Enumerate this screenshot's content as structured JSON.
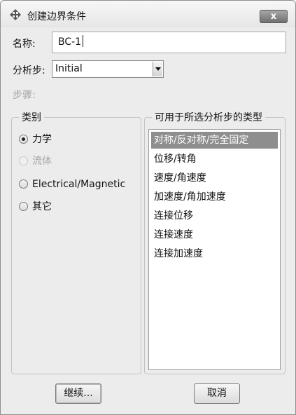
{
  "window": {
    "title": "创建边界条件",
    "close_label": "x"
  },
  "form": {
    "name_label": "名称:",
    "name_value": "BC-1",
    "step_label": "分析步:",
    "step_value": "Initial",
    "procedure_label": "步骤:"
  },
  "category": {
    "legend": "类别",
    "options": [
      {
        "label": "力学",
        "checked": true,
        "enabled": true
      },
      {
        "label": "流体",
        "checked": false,
        "enabled": false
      },
      {
        "label": "Electrical/Magnetic",
        "checked": false,
        "enabled": true
      },
      {
        "label": "其它",
        "checked": false,
        "enabled": true
      }
    ]
  },
  "types": {
    "legend": "可用于所选分析步的类型",
    "items": [
      {
        "label": "对称/反对称/完全固定",
        "selected": true
      },
      {
        "label": "位移/转角",
        "selected": false
      },
      {
        "label": "速度/角速度",
        "selected": false
      },
      {
        "label": "加速度/角加速度",
        "selected": false
      },
      {
        "label": "连接位移",
        "selected": false
      },
      {
        "label": "连接速度",
        "selected": false
      },
      {
        "label": "连接加速度",
        "selected": false
      }
    ]
  },
  "buttons": {
    "continue_label": "继续...",
    "cancel_label": "取消"
  }
}
